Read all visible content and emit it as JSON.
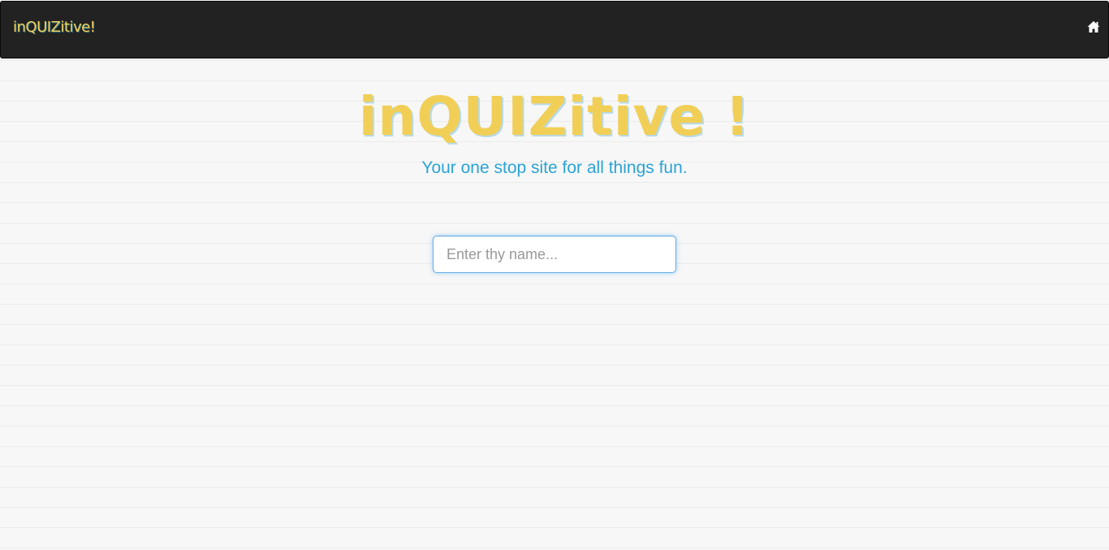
{
  "navbar": {
    "brand": "inQUIZitive!",
    "home_icon": "home-icon"
  },
  "hero": {
    "title": "inQUIZitive !",
    "subtitle": "Your one stop site for all things fun."
  },
  "name_input": {
    "value": "",
    "placeholder": "Enter thy name..."
  },
  "colors": {
    "navbar_bg": "#222222",
    "brand_yellow": "#f1cf57",
    "subtitle_blue": "#2aa3d5",
    "input_focus_border": "#66afe9",
    "page_bg": "#f7f7f7"
  }
}
